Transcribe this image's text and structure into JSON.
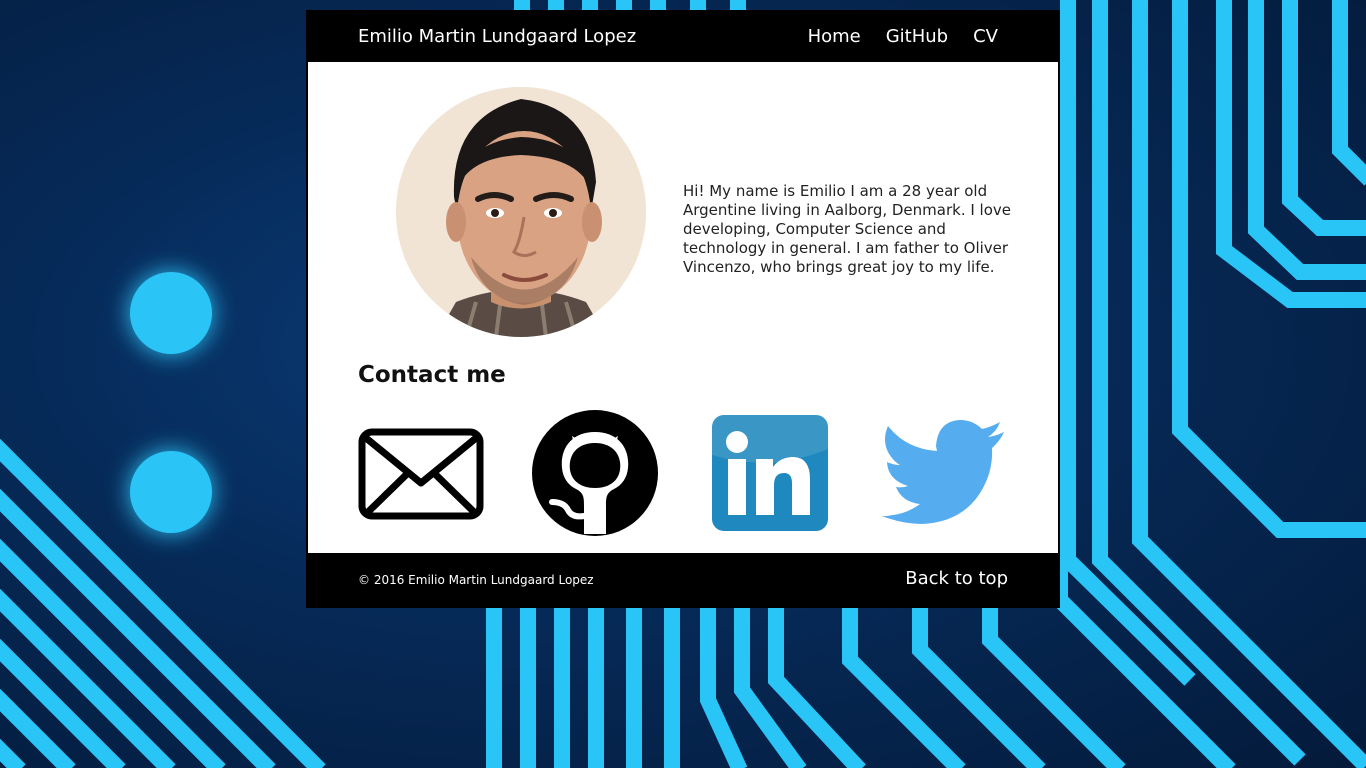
{
  "header": {
    "site_title": "Emilio Martin Lundgaard Lopez",
    "nav": [
      {
        "label": "Home"
      },
      {
        "label": "GitHub"
      },
      {
        "label": "CV"
      }
    ]
  },
  "profile": {
    "bio": "Hi! My name is Emilio I am a 28 year old Argentine living in Aalborg, Denmark. I love developing, Computer Science and technology in general. I am father to Oliver Vincenzo, who brings great joy to my life."
  },
  "contact": {
    "heading": "Contact me",
    "links": [
      {
        "icon": "mail-icon"
      },
      {
        "icon": "github-icon"
      },
      {
        "icon": "linkedin-icon"
      },
      {
        "icon": "twitter-icon"
      }
    ]
  },
  "footer": {
    "copyright": "© 2016 Emilio Martin Lundgaard Lopez",
    "back_to_top": "Back to top"
  },
  "colors": {
    "accent": "#29c5f6",
    "background_dark": "#062a58",
    "linkedin": "#1f88be",
    "twitter": "#55acee"
  }
}
